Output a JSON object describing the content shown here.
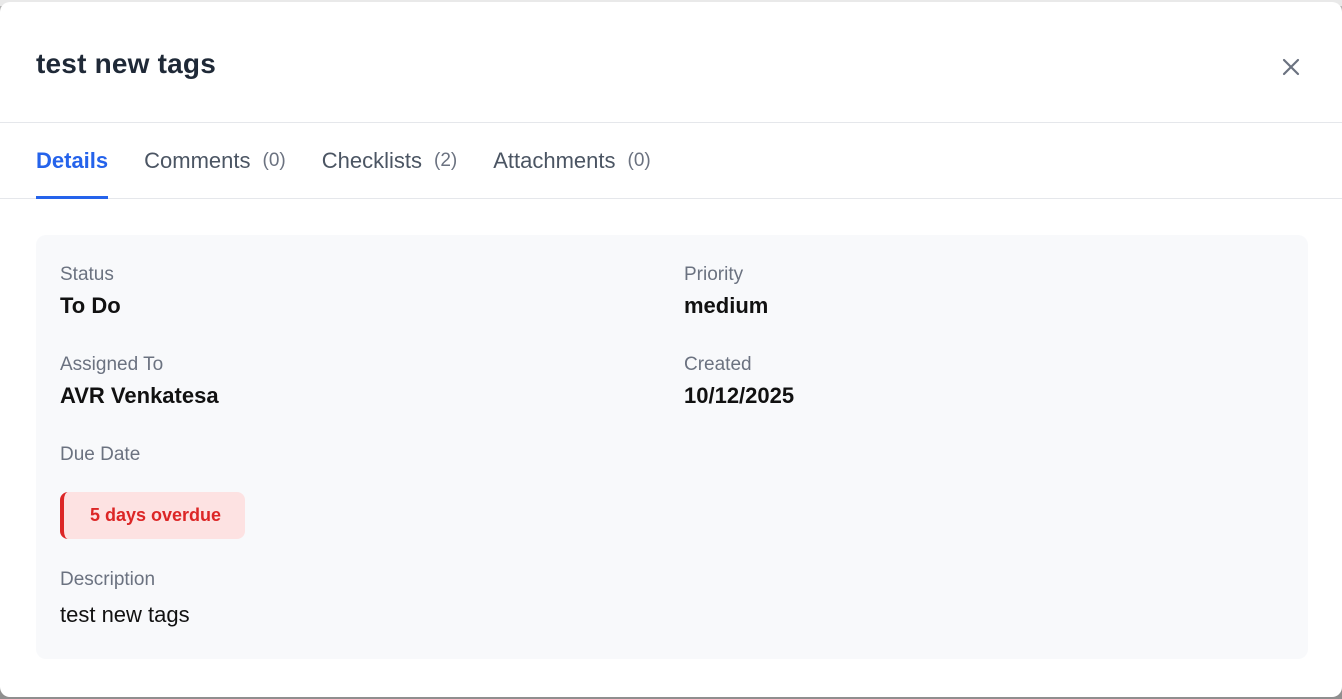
{
  "modal": {
    "title": "test new tags",
    "close_label": "×"
  },
  "tabs": [
    {
      "label": "Details",
      "count": "",
      "active": true
    },
    {
      "label": "Comments",
      "count": "(0)",
      "active": false
    },
    {
      "label": "Checklists",
      "count": "(2)",
      "active": false
    },
    {
      "label": "Attachments",
      "count": "(0)",
      "active": false
    }
  ],
  "details": {
    "status_label": "Status",
    "status_value": "To Do",
    "priority_label": "Priority",
    "priority_value": "medium",
    "assigned_label": "Assigned To",
    "assigned_value": "AVR Venkatesa",
    "created_label": "Created",
    "created_value": "10/12/2025",
    "due_label": "Due Date",
    "due_badge": "5 days overdue",
    "description_label": "Description",
    "description_value": "test new tags"
  },
  "colors": {
    "accent": "#2563eb",
    "overdue_text": "#dc2626",
    "overdue_bg": "#fde2e2",
    "panel_bg": "#f8f9fb"
  },
  "icons": {
    "close": "close-icon"
  }
}
